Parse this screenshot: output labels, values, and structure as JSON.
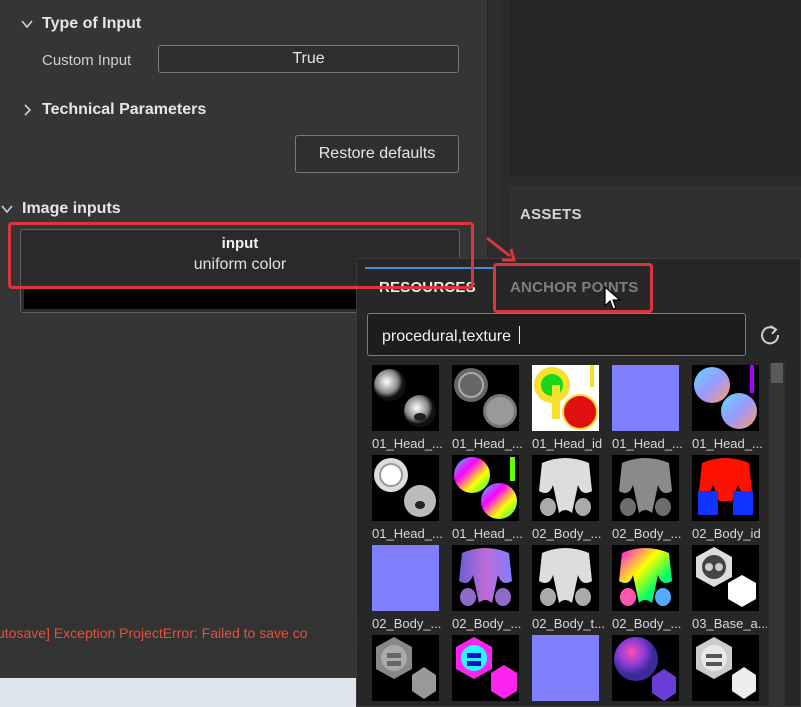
{
  "type_of_input": {
    "title": "Type of Input",
    "custom_input_label": "Custom Input",
    "custom_input_value": "True"
  },
  "technical_parameters": {
    "title": "Technical Parameters",
    "restore_label": "Restore defaults"
  },
  "image_inputs": {
    "title": "Image inputs",
    "input_name": "input",
    "input_type": "uniform color"
  },
  "status_text": "utosave] Exception ProjectError: Failed to save co",
  "assets": {
    "title": "ASSETS"
  },
  "popup": {
    "tabs": [
      {
        "label": "RESOURCES",
        "active": true
      },
      {
        "label": "ANCHOR POINTS",
        "active": false
      }
    ],
    "search_value": "procedural,texture ",
    "items": [
      {
        "label": "01_Head_...",
        "thumb": "spheres-bw"
      },
      {
        "label": "01_Head_...",
        "thumb": "spheres-gray-rings"
      },
      {
        "label": "01_Head_id",
        "thumb": "id-yellow-red"
      },
      {
        "label": "01_Head_...",
        "thumb": "flat-blue"
      },
      {
        "label": "01_Head_...",
        "thumb": "normal-spheres"
      },
      {
        "label": "01_Head_...",
        "thumb": "spheres-bw-rings"
      },
      {
        "label": "01_Head_...",
        "thumb": "rainbow-spheres"
      },
      {
        "label": "02_Body_...",
        "thumb": "body-bw"
      },
      {
        "label": "02_Body_...",
        "thumb": "body-gray"
      },
      {
        "label": "02_Body_id",
        "thumb": "body-id"
      },
      {
        "label": "02_Body_...",
        "thumb": "flat-blue"
      },
      {
        "label": "02_Body_...",
        "thumb": "body-normal"
      },
      {
        "label": "02_Body_t...",
        "thumb": "body-bw"
      },
      {
        "label": "02_Body_...",
        "thumb": "body-rainbow"
      },
      {
        "label": "03_Base_a...",
        "thumb": "base-white"
      },
      {
        "label": "",
        "thumb": "base-gray"
      },
      {
        "label": "",
        "thumb": "base-magenta"
      },
      {
        "label": "",
        "thumb": "flat-blue"
      },
      {
        "label": "",
        "thumb": "base-normal"
      },
      {
        "label": "",
        "thumb": "base-white2"
      }
    ]
  },
  "colors": {
    "accent_blue": "#3d8de0",
    "error_red": "#e3523d",
    "annotation_red": "#d9363e"
  }
}
